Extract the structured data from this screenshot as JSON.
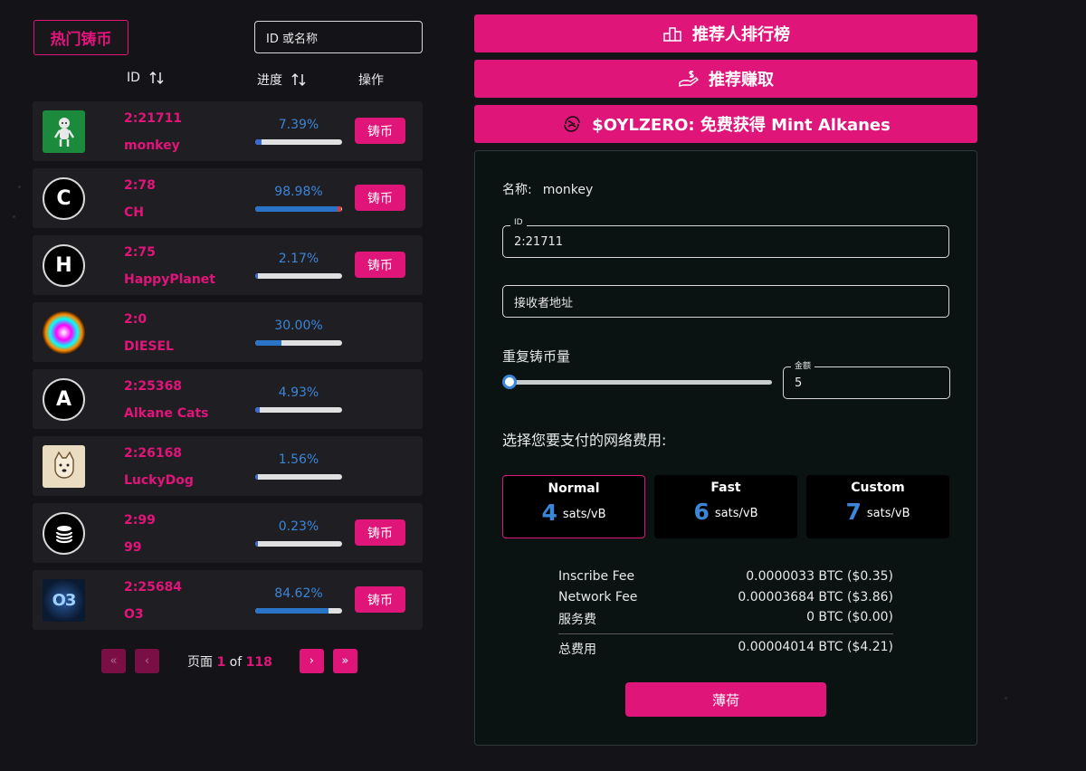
{
  "left": {
    "title": "热门铸币",
    "search_placeholder": "ID 或名称",
    "columns": {
      "id": "ID",
      "progress": "进度",
      "action": "操作"
    },
    "rows": [
      {
        "id": "2:21711",
        "name": "monkey",
        "pct": "7.39%",
        "progress": 0.0739,
        "avatar": "monkey-icon",
        "mint": "铸币",
        "letter": ""
      },
      {
        "id": "2:78",
        "name": "CH",
        "pct": "98.98%",
        "progress": 0.9898,
        "avatar": "letter-c-icon",
        "mint": "铸币",
        "letter": "C"
      },
      {
        "id": "2:75",
        "name": "HappyPlanet",
        "pct": "2.17%",
        "progress": 0.0217,
        "avatar": "letter-h-icon",
        "mint": "铸币",
        "letter": "H"
      },
      {
        "id": "2:0",
        "name": "DIESEL",
        "pct": "30.00%",
        "progress": 0.3,
        "avatar": "diesel-icon",
        "mint": "",
        "letter": ""
      },
      {
        "id": "2:25368",
        "name": "Alkane Cats",
        "pct": "4.93%",
        "progress": 0.0493,
        "avatar": "letter-a-icon",
        "mint": "",
        "letter": "A"
      },
      {
        "id": "2:26168",
        "name": "LuckyDog",
        "pct": "1.56%",
        "progress": 0.0156,
        "avatar": "dog-icon",
        "mint": "",
        "letter": ""
      },
      {
        "id": "2:99",
        "name": "99",
        "pct": "0.23%",
        "progress": 0.0023,
        "avatar": "coin-stack-icon",
        "mint": "铸币",
        "letter": ""
      },
      {
        "id": "2:25684",
        "name": "O3",
        "pct": "84.62%",
        "progress": 0.8462,
        "avatar": "o3-icon",
        "mint": "铸币",
        "letter": ""
      }
    ],
    "pager": {
      "prefix": "页面",
      "current": "1",
      "of": "of",
      "total": "118"
    }
  },
  "right": {
    "leaderboard": "推荐人排行榜",
    "earn": "推荐赚取",
    "zero": "$OYLZERO: 免费获得 Mint Alkanes",
    "name_label": "名称:",
    "name_value": "monkey",
    "id_legend": "ID",
    "id_value": "2:21711",
    "receiver_placeholder": "接收者地址",
    "repeat_label": "重复铸币量",
    "amount_legend": "金额",
    "amount_value": "5",
    "repeat_level": 0,
    "fee_title": "选择您要支付的网络费用:",
    "fee_options": [
      {
        "name": "Normal",
        "rate": "4",
        "unit": "sats/vB"
      },
      {
        "name": "Fast",
        "rate": "6",
        "unit": "sats/vB"
      },
      {
        "name": "Custom",
        "rate": "7",
        "unit": "sats/vB"
      }
    ],
    "summary": [
      {
        "label": "Inscribe Fee",
        "value": "0.0000033 BTC ($0.35)"
      },
      {
        "label": "Network Fee",
        "value": "0.00003684 BTC ($3.86)"
      },
      {
        "label": "服务费",
        "value": "0 BTC ($0.00)"
      }
    ],
    "total": {
      "label": "总费用",
      "value": "0.00004014 BTC ($4.21)"
    },
    "mint_button": "薄荷"
  },
  "colors": {
    "accent": "#e0157a",
    "blue": "#3a86d8",
    "panel": "#0a1212"
  }
}
